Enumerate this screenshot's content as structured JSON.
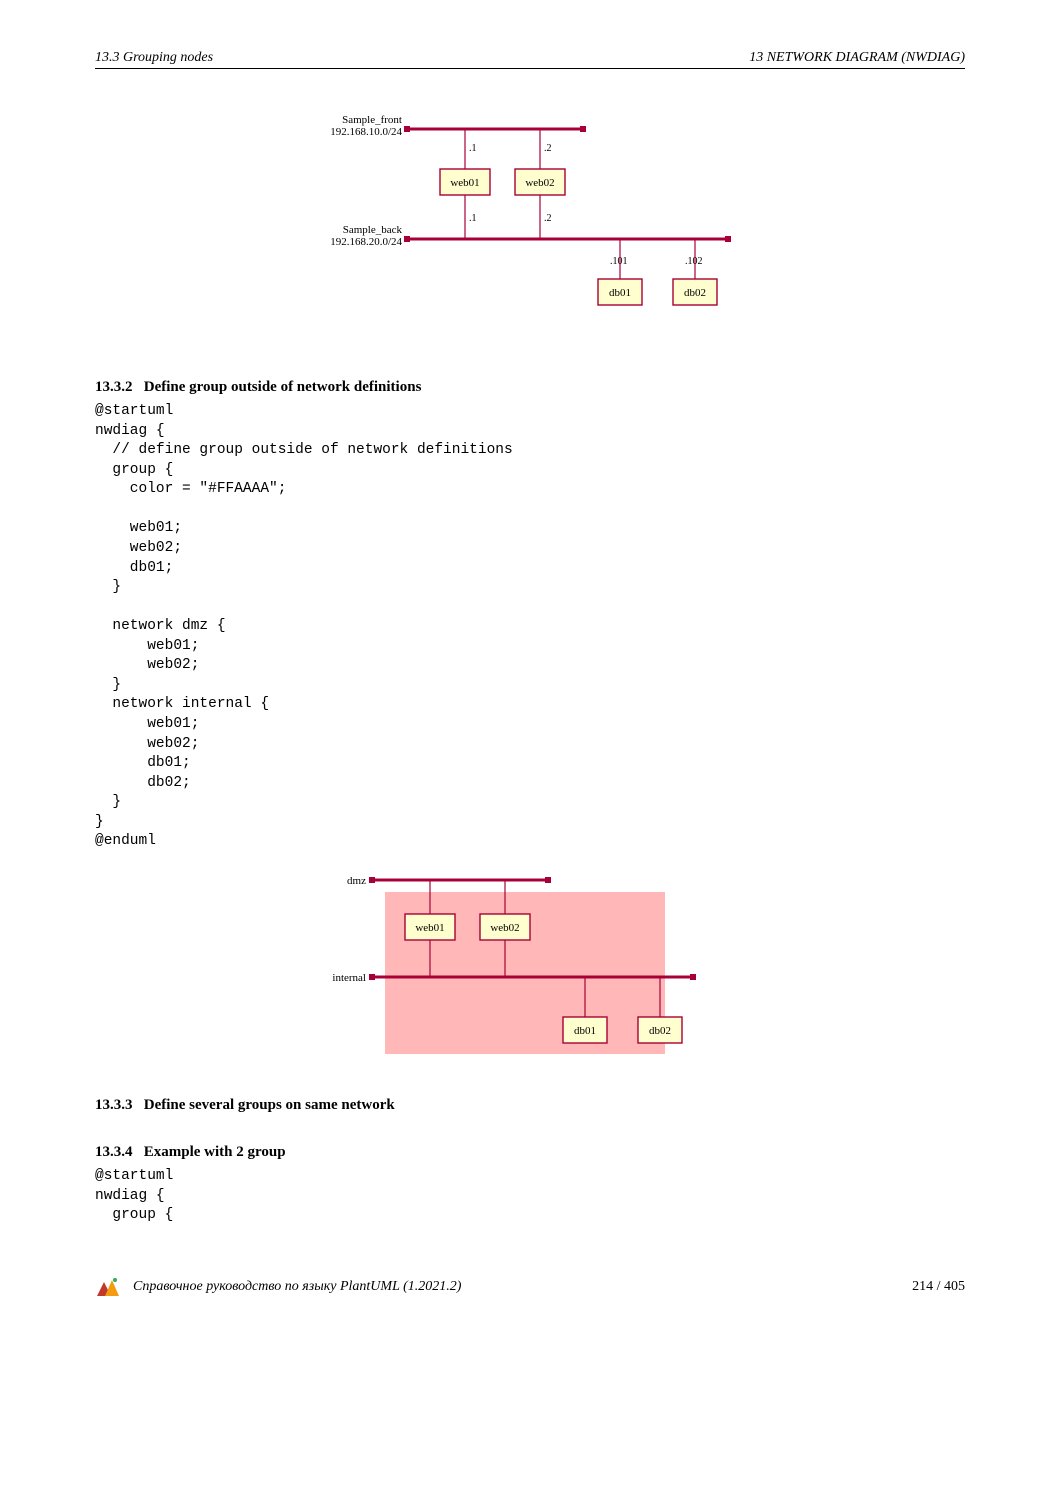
{
  "header": {
    "left": "13.3   Grouping nodes",
    "right": "13   NETWORK DIAGRAM (NWDIAG)"
  },
  "diagram1": {
    "net1_name": "Sample_front",
    "net1_cidr": "192.168.10.0/24",
    "net2_name": "Sample_back",
    "net2_cidr": "192.168.20.0/24",
    "web01": "web01",
    "web02": "web02",
    "db01": "db01",
    "db02": "db02",
    "p1": ".1",
    "p2": ".2",
    "p101": ".101",
    "p102": ".102"
  },
  "section1": {
    "num": "13.3.2",
    "title": "Define group outside of network definitions"
  },
  "code1": "@startuml\nnwdiag {\n  // define group outside of network definitions\n  group {\n    color = \"#FFAAAA\";\n\n    web01;\n    web02;\n    db01;\n  }\n\n  network dmz {\n      web01;\n      web02;\n  }\n  network internal {\n      web01;\n      web02;\n      db01;\n      db02;\n  }\n}\n@enduml",
  "diagram2": {
    "dmz": "dmz",
    "internal": "internal",
    "web01": "web01",
    "web02": "web02",
    "db01": "db01",
    "db02": "db02"
  },
  "section2": {
    "num": "13.3.3",
    "title": "Define several groups on same network"
  },
  "section3": {
    "num": "13.3.4",
    "title": "Example with 2 group"
  },
  "code2": "@startuml\nnwdiag {\n  group {",
  "footer": {
    "text": "Справочное руководство по языку PlantUML (1.2021.2)",
    "page": "214 / 405"
  }
}
